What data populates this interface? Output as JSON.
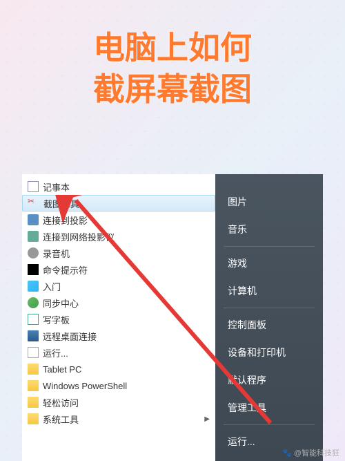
{
  "title_line1": "电脑上如何",
  "title_line2": "截屏幕截图",
  "left_menu": [
    {
      "label": "记事本",
      "icon": "notepad",
      "highlighted": false,
      "arrow": false
    },
    {
      "label": "截图工具",
      "icon": "snipping-tool",
      "highlighted": true,
      "arrow": false
    },
    {
      "label": "连接到投影",
      "icon": "projector",
      "highlighted": false,
      "arrow": false
    },
    {
      "label": "连接到网络投影仪",
      "icon": "network-projector",
      "highlighted": false,
      "arrow": false
    },
    {
      "label": "录音机",
      "icon": "recorder",
      "highlighted": false,
      "arrow": false
    },
    {
      "label": "命令提示符",
      "icon": "cmd",
      "highlighted": false,
      "arrow": false
    },
    {
      "label": "入门",
      "icon": "intro",
      "highlighted": false,
      "arrow": false
    },
    {
      "label": "同步中心",
      "icon": "sync",
      "highlighted": false,
      "arrow": false
    },
    {
      "label": "写字板",
      "icon": "wordpad",
      "highlighted": false,
      "arrow": false
    },
    {
      "label": "远程桌面连接",
      "icon": "rdp",
      "highlighted": false,
      "arrow": false
    },
    {
      "label": "运行...",
      "icon": "run",
      "highlighted": false,
      "arrow": false
    },
    {
      "label": "Tablet PC",
      "icon": "folder",
      "highlighted": false,
      "arrow": false
    },
    {
      "label": "Windows PowerShell",
      "icon": "folder",
      "highlighted": false,
      "arrow": false
    },
    {
      "label": "轻松访问",
      "icon": "folder",
      "highlighted": false,
      "arrow": false
    },
    {
      "label": "系统工具",
      "icon": "folder",
      "highlighted": false,
      "arrow": true
    }
  ],
  "right_menu": {
    "group1": [
      "图片",
      "音乐"
    ],
    "group2": [
      "游戏",
      "计算机"
    ],
    "group3": [
      "控制面板",
      "设备和打印机",
      "默认程序",
      "管理工具"
    ],
    "group4": [
      "运行..."
    ]
  },
  "watermark": "@智能科技狂"
}
